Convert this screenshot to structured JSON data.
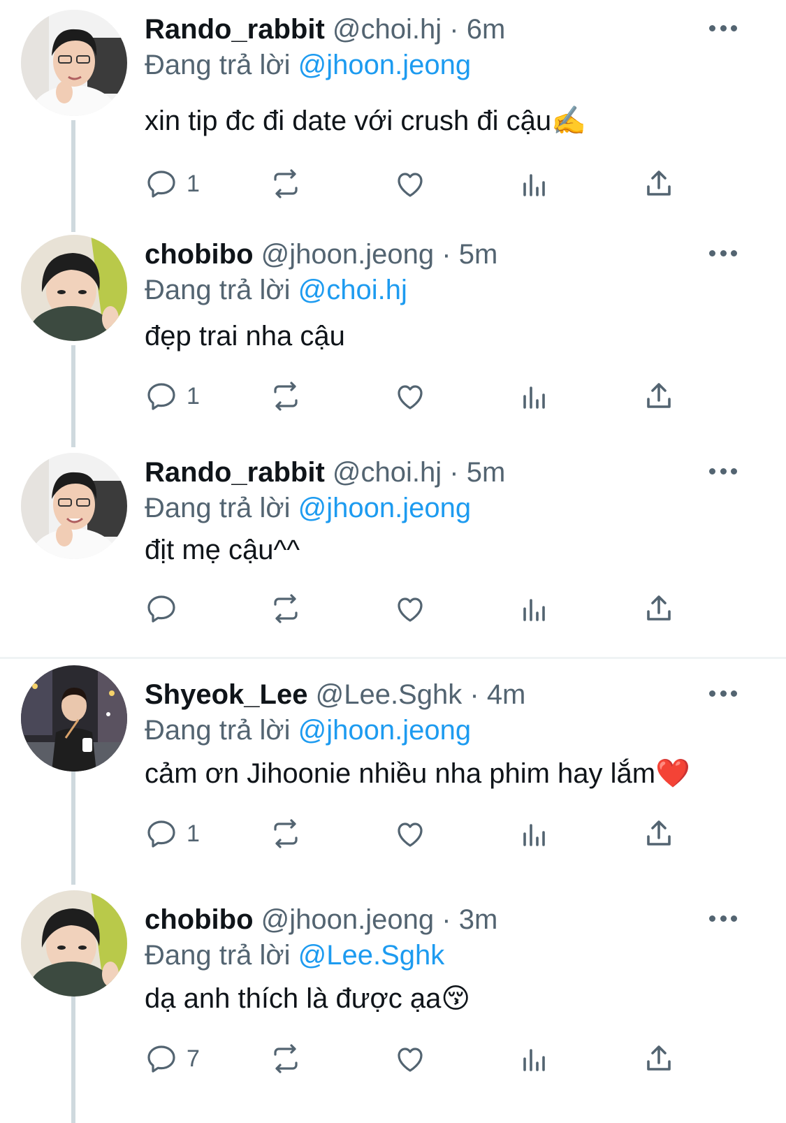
{
  "tweets": [
    {
      "name": "Rando_rabbit",
      "handle": "@choi.hj",
      "dot": "·",
      "time": "6m",
      "reply_prefix": "Đang trả lời",
      "reply_to": "@jhoon.jeong",
      "text": "xin tip đc đi date với crush đi cậu✍️",
      "reply_count": "1",
      "avatar_icon": "avatar-rando-rabbit"
    },
    {
      "name": "chobibo",
      "handle": "@jhoon.jeong",
      "dot": "·",
      "time": "5m",
      "reply_prefix": "Đang trả lời",
      "reply_to": "@choi.hj",
      "text": "đẹp trai nha cậu",
      "reply_count": "1",
      "avatar_icon": "avatar-chobibo"
    },
    {
      "name": "Rando_rabbit",
      "handle": "@choi.hj",
      "dot": "·",
      "time": "5m",
      "reply_prefix": "Đang trả lời",
      "reply_to": "@jhoon.jeong",
      "text": "địt mẹ cậu^^",
      "reply_count": "",
      "avatar_icon": "avatar-rando-rabbit"
    },
    {
      "name": "Shyeok_Lee",
      "handle": "@Lee.Sghk",
      "dot": "·",
      "time": "4m",
      "reply_prefix": "Đang trả lời",
      "reply_to": "@jhoon.jeong",
      "text": "cảm ơn Jihoonie nhiều nha phim hay lắm❤️",
      "reply_count": "1",
      "avatar_icon": "avatar-shyeok-lee"
    },
    {
      "name": "chobibo",
      "handle": "@jhoon.jeong",
      "dot": "·",
      "time": "3m",
      "reply_prefix": "Đang trả lời",
      "reply_to": "@Lee.Sghk",
      "text": "dạ anh thích là được ạa😚",
      "reply_count": "7",
      "avatar_icon": "avatar-chobibo"
    }
  ],
  "icons": {
    "reply": "reply-bubble-icon",
    "retweet": "retweet-icon",
    "like": "heart-icon",
    "views": "analytics-bars-icon",
    "share": "share-upload-icon",
    "more": "more-dots-icon"
  },
  "colors": {
    "mention": "#1d9bf0",
    "secondary_text": "#536471",
    "thread_line": "#cfd9de"
  }
}
